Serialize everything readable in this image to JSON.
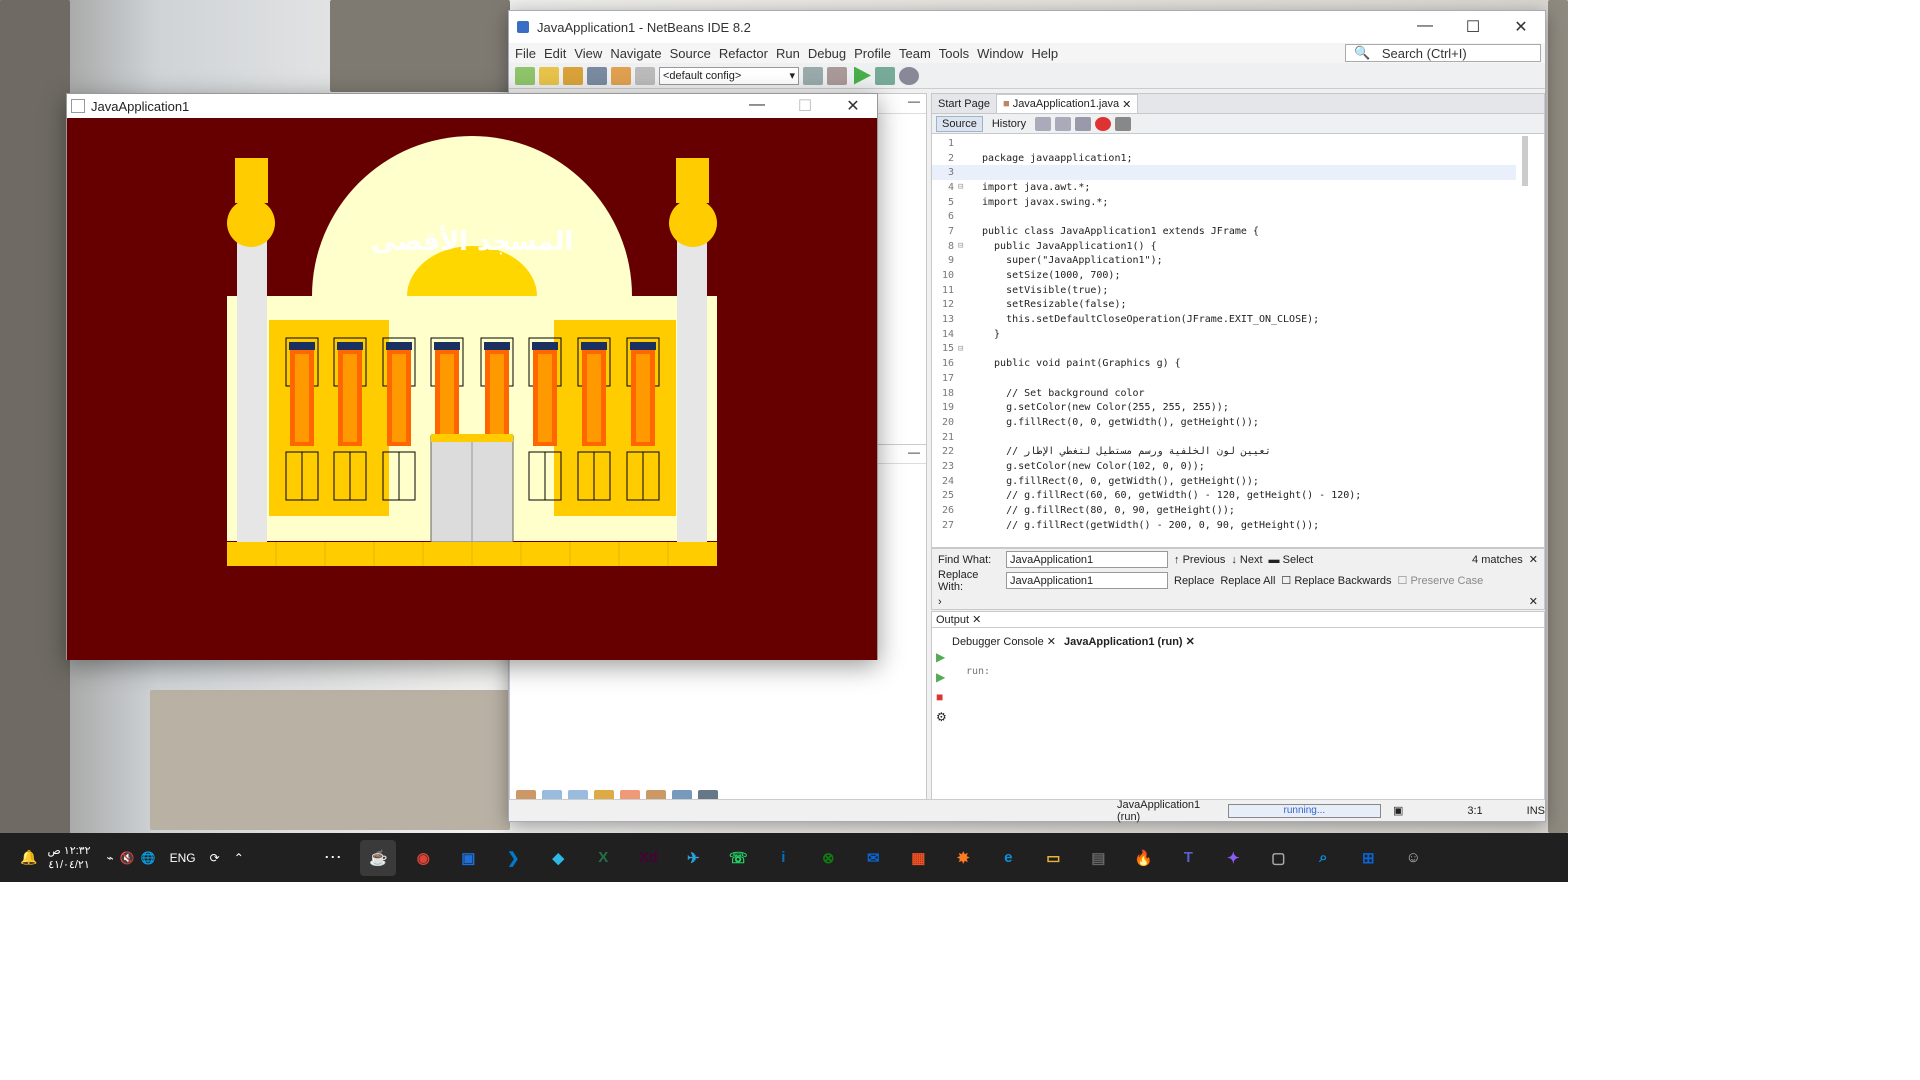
{
  "netbeans": {
    "title": "JavaApplication1 - NetBeans IDE 8.2",
    "menu": [
      "File",
      "Edit",
      "View",
      "Navigate",
      "Source",
      "Refactor",
      "Run",
      "Debug",
      "Profile",
      "Team",
      "Tools",
      "Window",
      "Help"
    ],
    "search_placeholder": "Search (Ctrl+I)",
    "config": "<default config>",
    "tabs": [
      "Start Page",
      "JavaApplication1.java"
    ],
    "editor_modes": [
      "Source",
      "History"
    ],
    "code": [
      "",
      "package javaapplication1;",
      "",
      "import java.awt.*;",
      "import javax.swing.*;",
      "",
      "public class JavaApplication1 extends JFrame {",
      "  public JavaApplication1() {",
      "    super(\"JavaApplication1\");",
      "    setSize(1000, 700);",
      "    setVisible(true);",
      "    setResizable(false);",
      "    this.setDefaultCloseOperation(JFrame.EXIT_ON_CLOSE);",
      "  }",
      "",
      "  public void paint(Graphics g) {",
      "",
      "    // Set background color",
      "    g.setColor(new Color(255, 255, 255));",
      "    g.fillRect(0, 0, getWidth(), getHeight());",
      "",
      "    // تعيين لون الخلفية ورسم مستطيل لتغطي الإطار",
      "    g.setColor(new Color(102, 0, 0));",
      "    g.fillRect(0, 0, getWidth(), getHeight());",
      "    // g.fillRect(60, 60, getWidth() - 120, getHeight() - 120);",
      "    // g.fillRect(80, 0, 90, getHeight());",
      "    // g.fillRect(getWidth() - 200, 0, 90, getHeight());"
    ],
    "find": {
      "find_label": "Find What:",
      "find_value": "JavaApplication1",
      "replace_label": "Replace With:",
      "replace_value": "JavaApplication1",
      "previous": "Previous",
      "next": "Next",
      "select": "Select",
      "matches": "4 matches",
      "replace": "Replace",
      "replace_all": "Replace All",
      "replace_backwards": "Replace Backwards",
      "preserve_case": "Preserve Case"
    },
    "output": {
      "title": "Output",
      "tabs": [
        "Debugger Console",
        "JavaApplication1 (run)"
      ],
      "text": "run:"
    },
    "status": {
      "task": "JavaApplication1 (run)",
      "progress": "running...",
      "position": "3:1",
      "mode": "INS"
    }
  },
  "japp": {
    "title": "JavaApplication1",
    "arabic_title": "المسجد الأقصى"
  },
  "taskbar": {
    "time": "١٢:٣٢ ص",
    "date": "٤١/٠٤/٢١",
    "lang": "ENG",
    "apps": [
      "java-icon",
      "chrome-icon",
      "app-icon",
      "vscode-icon",
      "app-icon",
      "excel-icon",
      "xd-icon",
      "telegram-icon",
      "whatsapp-icon",
      "intel-icon",
      "xbox-icon",
      "outlook-icon",
      "store-icon",
      "xampp-icon",
      "edge-icon",
      "explorer-icon",
      "calculator-icon",
      "firefox-icon",
      "teams-icon",
      "copilot-icon",
      "window-icon",
      "search-icon",
      "windows-icon",
      "avatar-icon"
    ]
  },
  "colors": {
    "maroon": "#660000",
    "gold": "#ffcc00",
    "cream": "#ffffcc",
    "orange": "#ff8c00",
    "accent": "#0a64d2"
  }
}
